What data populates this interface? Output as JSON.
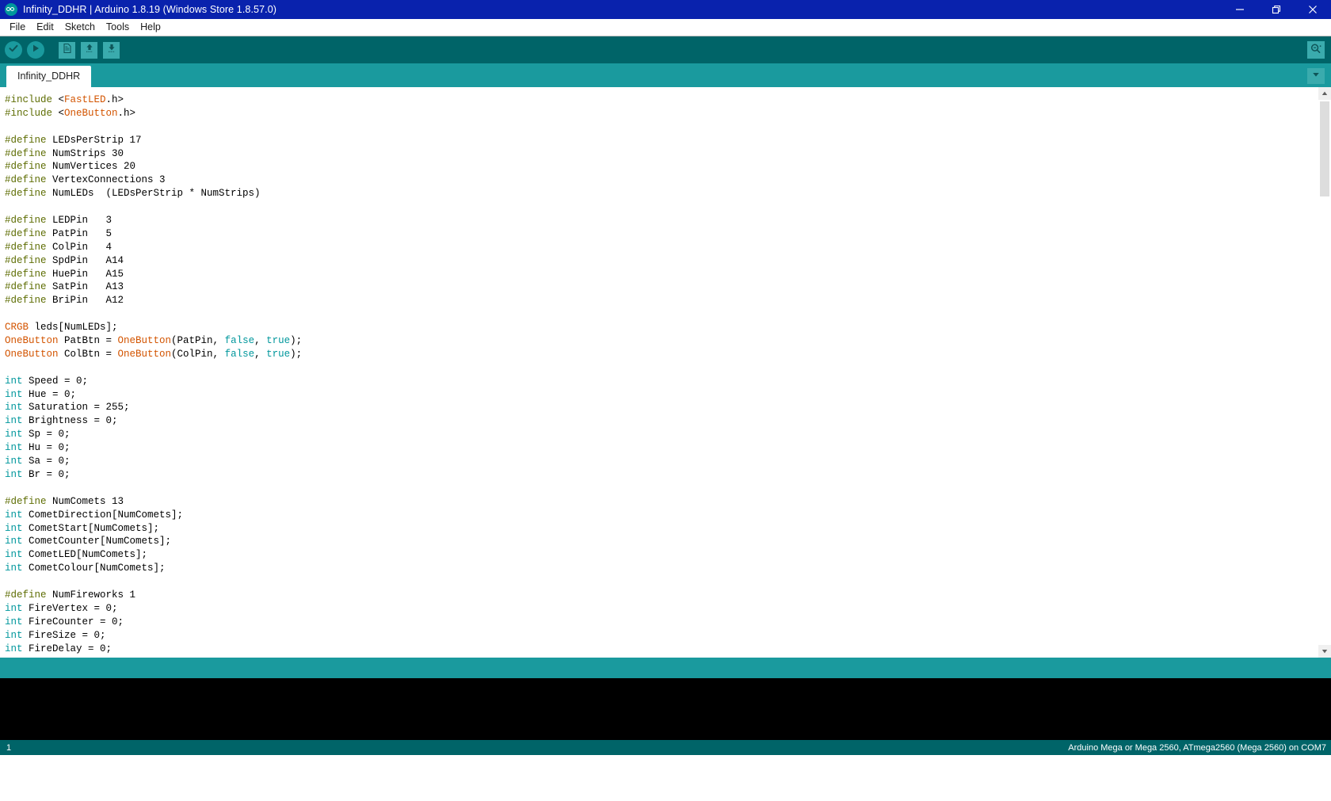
{
  "window": {
    "title": "Infinity_DDHR | Arduino 1.8.19 (Windows Store 1.8.57.0)",
    "app_icon": "arduino-logo-icon",
    "controls": {
      "minimize": "minimize-icon",
      "maximize": "restore-icon",
      "close": "close-icon"
    },
    "titlebar_color": "#0922ad"
  },
  "menubar": {
    "items": [
      {
        "label": "File"
      },
      {
        "label": "Edit"
      },
      {
        "label": "Sketch"
      },
      {
        "label": "Tools"
      },
      {
        "label": "Help"
      }
    ]
  },
  "toolbar": {
    "verify_label": "Verify",
    "upload_label": "Upload",
    "new_label": "New",
    "open_label": "Open",
    "save_label": "Save",
    "serial_monitor_label": "Serial Monitor",
    "background_color": "#006468",
    "accent_color": "#1a9a9e"
  },
  "tabs": {
    "items": [
      {
        "label": "Infinity_DDHR",
        "active": true
      }
    ],
    "menu_button": "chevron-down-icon"
  },
  "editor": {
    "font_size": "12.5px",
    "lines": [
      [
        {
          "t": "#include ",
          "c": "pre"
        },
        {
          "t": "<",
          "c": "plain"
        },
        {
          "t": "FastLED",
          "c": "lib"
        },
        {
          "t": ".h>",
          "c": "plain"
        }
      ],
      [
        {
          "t": "#include ",
          "c": "pre"
        },
        {
          "t": "<",
          "c": "plain"
        },
        {
          "t": "OneButton",
          "c": "lib"
        },
        {
          "t": ".h>",
          "c": "plain"
        }
      ],
      [],
      [
        {
          "t": "#define",
          "c": "pre"
        },
        {
          "t": " LEDsPerStrip 17",
          "c": "plain"
        }
      ],
      [
        {
          "t": "#define",
          "c": "pre"
        },
        {
          "t": " NumStrips 30",
          "c": "plain"
        }
      ],
      [
        {
          "t": "#define",
          "c": "pre"
        },
        {
          "t": " NumVertices 20",
          "c": "plain"
        }
      ],
      [
        {
          "t": "#define",
          "c": "pre"
        },
        {
          "t": " VertexConnections 3",
          "c": "plain"
        }
      ],
      [
        {
          "t": "#define",
          "c": "pre"
        },
        {
          "t": " NumLEDs  (LEDsPerStrip * NumStrips)",
          "c": "plain"
        }
      ],
      [],
      [
        {
          "t": "#define",
          "c": "pre"
        },
        {
          "t": " LEDPin   3",
          "c": "plain"
        }
      ],
      [
        {
          "t": "#define",
          "c": "pre"
        },
        {
          "t": " PatPin   5",
          "c": "plain"
        }
      ],
      [
        {
          "t": "#define",
          "c": "pre"
        },
        {
          "t": " ColPin   4",
          "c": "plain"
        }
      ],
      [
        {
          "t": "#define",
          "c": "pre"
        },
        {
          "t": " SpdPin   A14",
          "c": "plain"
        }
      ],
      [
        {
          "t": "#define",
          "c": "pre"
        },
        {
          "t": " HuePin   A15",
          "c": "plain"
        }
      ],
      [
        {
          "t": "#define",
          "c": "pre"
        },
        {
          "t": " SatPin   A13",
          "c": "plain"
        }
      ],
      [
        {
          "t": "#define",
          "c": "pre"
        },
        {
          "t": " BriPin   A12",
          "c": "plain"
        }
      ],
      [],
      [
        {
          "t": "CRGB",
          "c": "lib"
        },
        {
          "t": " leds[NumLEDs];",
          "c": "plain"
        }
      ],
      [
        {
          "t": "OneButton",
          "c": "lib"
        },
        {
          "t": " PatBtn = ",
          "c": "plain"
        },
        {
          "t": "OneButton",
          "c": "lib"
        },
        {
          "t": "(PatPin, ",
          "c": "plain"
        },
        {
          "t": "false",
          "c": "kw"
        },
        {
          "t": ", ",
          "c": "plain"
        },
        {
          "t": "true",
          "c": "kw"
        },
        {
          "t": ");",
          "c": "plain"
        }
      ],
      [
        {
          "t": "OneButton",
          "c": "lib"
        },
        {
          "t": " ColBtn = ",
          "c": "plain"
        },
        {
          "t": "OneButton",
          "c": "lib"
        },
        {
          "t": "(ColPin, ",
          "c": "plain"
        },
        {
          "t": "false",
          "c": "kw"
        },
        {
          "t": ", ",
          "c": "plain"
        },
        {
          "t": "true",
          "c": "kw"
        },
        {
          "t": ");",
          "c": "plain"
        }
      ],
      [],
      [
        {
          "t": "int",
          "c": "type"
        },
        {
          "t": " Speed = 0;",
          "c": "plain"
        }
      ],
      [
        {
          "t": "int",
          "c": "type"
        },
        {
          "t": " Hue = 0;",
          "c": "plain"
        }
      ],
      [
        {
          "t": "int",
          "c": "type"
        },
        {
          "t": " Saturation = 255;",
          "c": "plain"
        }
      ],
      [
        {
          "t": "int",
          "c": "type"
        },
        {
          "t": " Brightness = 0;",
          "c": "plain"
        }
      ],
      [
        {
          "t": "int",
          "c": "type"
        },
        {
          "t": " Sp = 0;",
          "c": "plain"
        }
      ],
      [
        {
          "t": "int",
          "c": "type"
        },
        {
          "t": " Hu = 0;",
          "c": "plain"
        }
      ],
      [
        {
          "t": "int",
          "c": "type"
        },
        {
          "t": " Sa = 0;",
          "c": "plain"
        }
      ],
      [
        {
          "t": "int",
          "c": "type"
        },
        {
          "t": " Br = 0;",
          "c": "plain"
        }
      ],
      [],
      [
        {
          "t": "#define",
          "c": "pre"
        },
        {
          "t": " NumComets 13",
          "c": "plain"
        }
      ],
      [
        {
          "t": "int",
          "c": "type"
        },
        {
          "t": " CometDirection[NumComets];",
          "c": "plain"
        }
      ],
      [
        {
          "t": "int",
          "c": "type"
        },
        {
          "t": " CometStart[NumComets];",
          "c": "plain"
        }
      ],
      [
        {
          "t": "int",
          "c": "type"
        },
        {
          "t": " CometCounter[NumComets];",
          "c": "plain"
        }
      ],
      [
        {
          "t": "int",
          "c": "type"
        },
        {
          "t": " CometLED[NumComets];",
          "c": "plain"
        }
      ],
      [
        {
          "t": "int",
          "c": "type"
        },
        {
          "t": " CometColour[NumComets];",
          "c": "plain"
        }
      ],
      [],
      [
        {
          "t": "#define",
          "c": "pre"
        },
        {
          "t": " NumFireworks 1",
          "c": "plain"
        }
      ],
      [
        {
          "t": "int",
          "c": "type"
        },
        {
          "t": " FireVertex = 0;",
          "c": "plain"
        }
      ],
      [
        {
          "t": "int",
          "c": "type"
        },
        {
          "t": " FireCounter = 0;",
          "c": "plain"
        }
      ],
      [
        {
          "t": "int",
          "c": "type"
        },
        {
          "t": " FireSize = 0;",
          "c": "plain"
        }
      ],
      [
        {
          "t": "int",
          "c": "type"
        },
        {
          "t": " FireDelay = 0;",
          "c": "plain"
        }
      ]
    ]
  },
  "console": {
    "text": ""
  },
  "statusbar": {
    "line_number": "1",
    "board": "Arduino Mega or Mega 2560, ATmega2560 (Mega 2560) on COM7"
  }
}
